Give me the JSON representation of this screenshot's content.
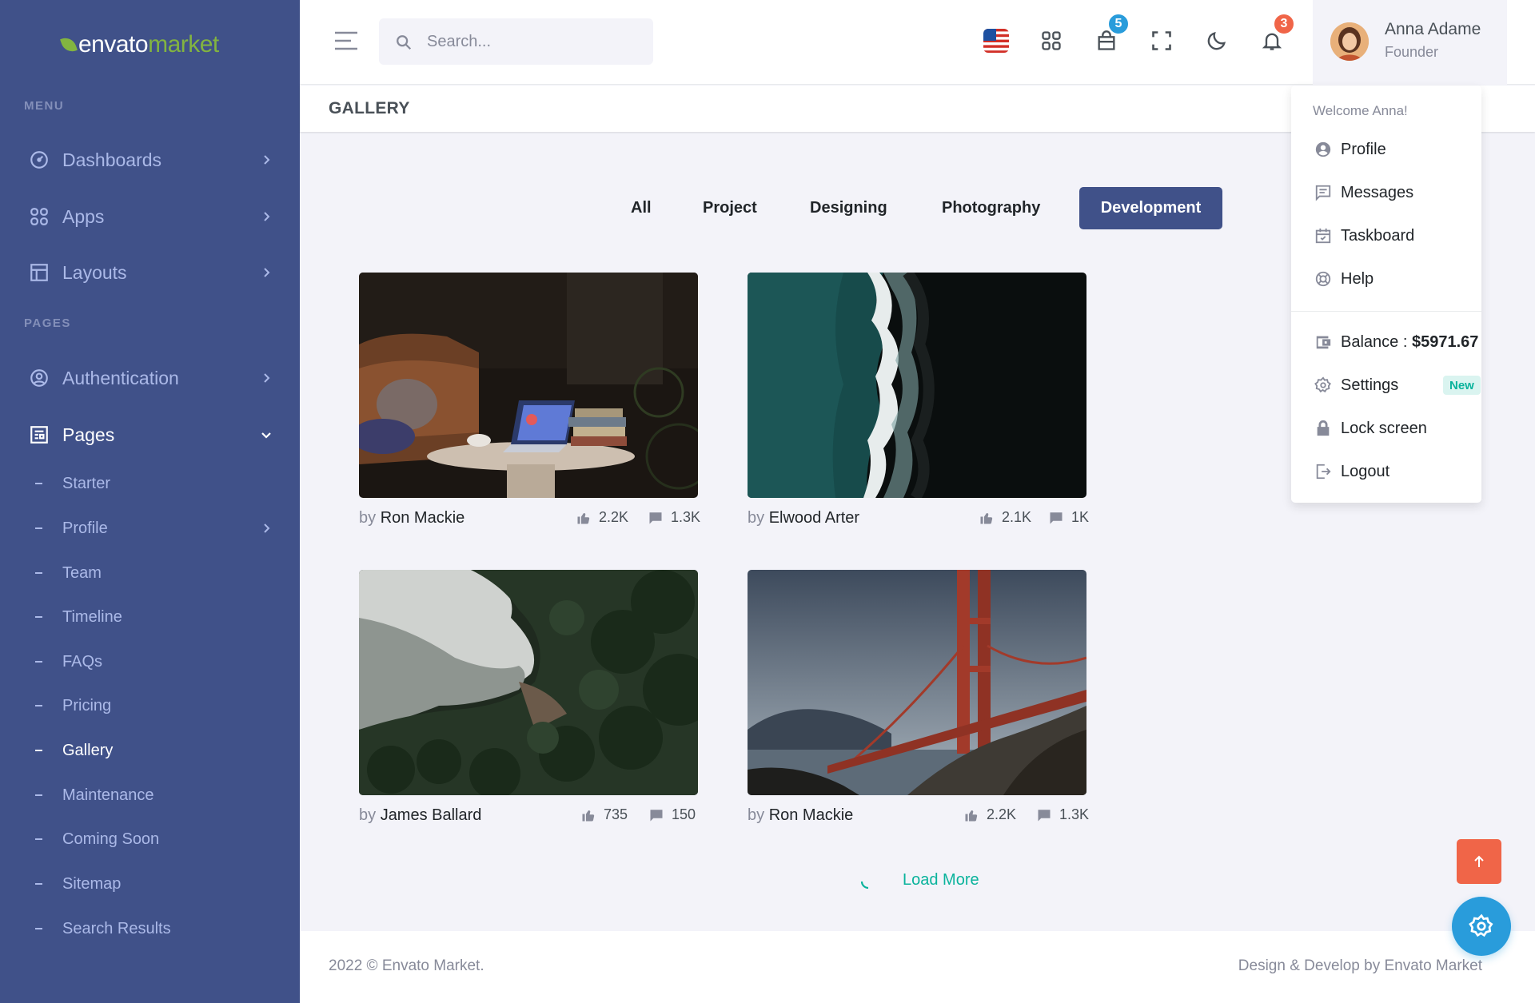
{
  "brand": {
    "word1": "envato",
    "word2": "market",
    "leaf_color": "#82b440"
  },
  "colors": {
    "sidebar": "#405189",
    "primary": "#405189",
    "success": "#0ab39c",
    "danger": "#f06548",
    "info": "#299cdb"
  },
  "sidebar": {
    "menu_title": "MENU",
    "pages_title": "PAGES",
    "items": [
      {
        "label": "Dashboards",
        "icon": "dashboard-icon"
      },
      {
        "label": "Apps",
        "icon": "apps-grid-icon"
      },
      {
        "label": "Layouts",
        "icon": "layout-icon"
      },
      {
        "label": "Authentication",
        "icon": "user-circle-icon"
      },
      {
        "label": "Pages",
        "icon": "pages-icon",
        "expanded": true
      }
    ],
    "sub_items": [
      {
        "label": "Starter"
      },
      {
        "label": "Profile",
        "has_children": true
      },
      {
        "label": "Team"
      },
      {
        "label": "Timeline"
      },
      {
        "label": "FAQs"
      },
      {
        "label": "Pricing"
      },
      {
        "label": "Gallery",
        "active": true
      },
      {
        "label": "Maintenance"
      },
      {
        "label": "Coming Soon"
      },
      {
        "label": "Sitemap"
      },
      {
        "label": "Search Results"
      }
    ]
  },
  "header": {
    "search_placeholder": "Search...",
    "cart_count": "5",
    "notification_count": "3",
    "user": {
      "name": "Anna Adame",
      "role": "Founder"
    }
  },
  "page": {
    "title": "GALLERY"
  },
  "filters": [
    {
      "label": "All"
    },
    {
      "label": "Project"
    },
    {
      "label": "Designing"
    },
    {
      "label": "Photography"
    },
    {
      "label": "Development",
      "active": true
    }
  ],
  "gallery": [
    {
      "by": "by",
      "author": "Ron Mackie",
      "likes": "2.2K",
      "comments": "1.3K",
      "image": "laptop-on-table"
    },
    {
      "by": "by",
      "author": "Elwood Arter",
      "likes": "2.1K",
      "comments": "1K",
      "image": "aerial-ocean-shore"
    },
    {
      "by": "by",
      "author": "James Ballard",
      "likes": "735",
      "comments": "150",
      "image": "forest-coastline"
    },
    {
      "by": "by",
      "author": "Ron Mackie",
      "likes": "2.2K",
      "comments": "1.3K",
      "image": "golden-gate-bridge"
    }
  ],
  "load_more": "Load More",
  "footer": {
    "left": "2022 © Envato Market.",
    "right": "Design & Develop by Envato Market"
  },
  "dropdown": {
    "welcome": "Welcome Anna!",
    "items": [
      {
        "label": "Profile",
        "icon": "account-circle-icon"
      },
      {
        "label": "Messages",
        "icon": "message-icon"
      },
      {
        "label": "Taskboard",
        "icon": "calendar-check-icon"
      },
      {
        "label": "Help",
        "icon": "lifebuoy-icon"
      }
    ],
    "balance_label": "Balance : ",
    "balance_value": "$5971.67",
    "settings_label": "Settings",
    "settings_badge": "New",
    "lock_label": "Lock screen",
    "logout_label": "Logout"
  }
}
